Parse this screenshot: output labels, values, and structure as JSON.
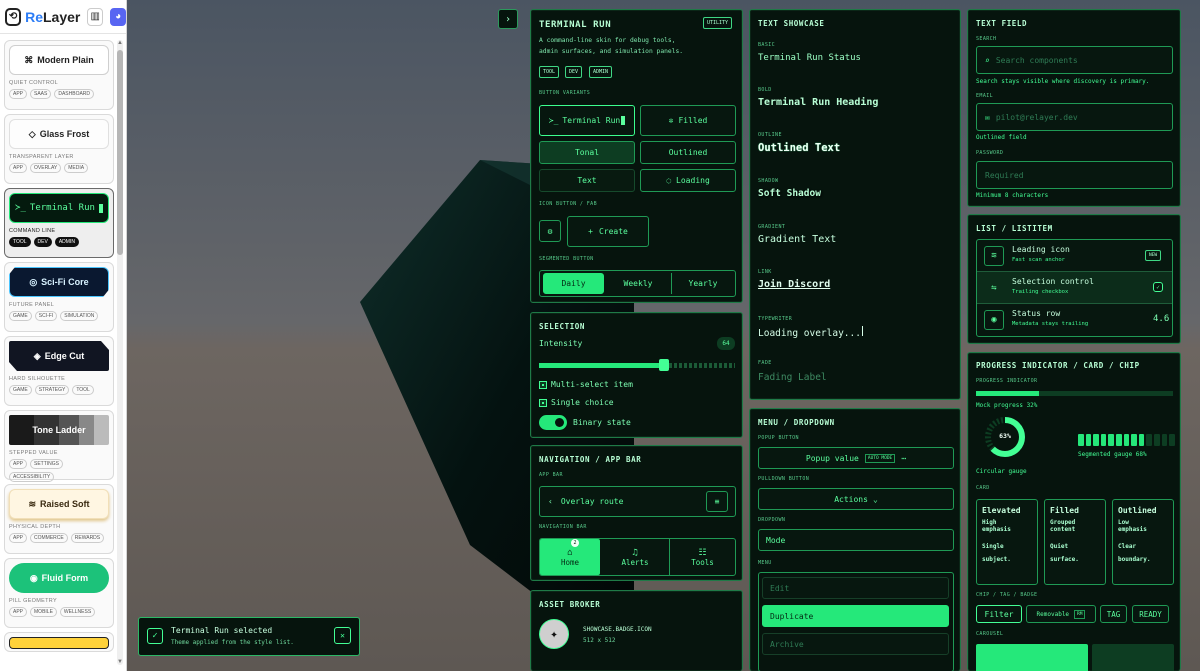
{
  "brand": {
    "name_prefix": "Re",
    "name_suffix": "Layer"
  },
  "sidebar": {
    "styles": [
      {
        "label": "Modern Plain",
        "icon": "⌘",
        "subtitle": "QUIET CONTROL",
        "tags": [
          "APP",
          "SAAS",
          "DASHBOARD"
        ]
      },
      {
        "label": "Glass Frost",
        "icon": "◇",
        "subtitle": "TRANSPARENT LAYER",
        "tags": [
          "APP",
          "OVERLAY",
          "MEDIA"
        ]
      },
      {
        "label": "Terminal Run",
        "icon": "≻_",
        "subtitle": "COMMAND LINE",
        "tags": [
          "TOOL",
          "DEV",
          "ADMIN"
        ]
      },
      {
        "label": "Sci-Fi Core",
        "icon": "◎",
        "subtitle": "FUTURE PANEL",
        "tags": [
          "GAME",
          "SCI-FI",
          "SIMULATION"
        ]
      },
      {
        "label": "Edge Cut",
        "icon": "◈",
        "subtitle": "HARD SILHOUETTE",
        "tags": [
          "GAME",
          "STRATEGY",
          "TOOL"
        ]
      },
      {
        "label": "Tone Ladder",
        "icon": "",
        "subtitle": "STEPPED VALUE",
        "tags": [
          "APP",
          "SETTINGS",
          "ACCESSIBILITY"
        ]
      },
      {
        "label": "Raised Soft",
        "icon": "≋",
        "subtitle": "PHYSICAL DEPTH",
        "tags": [
          "APP",
          "COMMERCE",
          "REWARDS"
        ]
      },
      {
        "label": "Fluid Form",
        "icon": "◉",
        "subtitle": "PILL GEOMETRY",
        "tags": [
          "APP",
          "MOBILE",
          "WELLNESS"
        ]
      }
    ]
  },
  "terminal": {
    "title": "TERMINAL RUN",
    "badge": "UTILITY",
    "description_1": "A command-line skin for debug tools,",
    "description_2": "admin surfaces, and simulation panels.",
    "tags": [
      "TOOL",
      "DEV",
      "ADMIN"
    ],
    "button_variants_label": "BUTTON VARIANTS",
    "buttons": {
      "primary": "Terminal Run",
      "filled": "Filled",
      "tonal": "Tonal",
      "outlined": "Outlined",
      "text": "Text",
      "loading": "Loading"
    },
    "icon_button_label": "ICON BUTTON / FAB",
    "create": "Create",
    "segmented_label": "SEGMENTED BUTTON",
    "segments": [
      "Daily",
      "Weekly",
      "Yearly"
    ]
  },
  "selection": {
    "title": "SELECTION",
    "intensity_label": "Intensity",
    "intensity_value": "64",
    "multi": "Multi-select item",
    "single": "Single choice",
    "binary": "Binary state"
  },
  "navigation": {
    "title": "NAVIGATION / APP BAR",
    "app_bar_label": "APP BAR",
    "route": "Overlay route",
    "nav_bar_label": "NAVIGATION BAR",
    "tabs": [
      "Home",
      "Alerts",
      "Tools"
    ],
    "home_badge": "2"
  },
  "asset": {
    "title": "ASSET BROKER",
    "name": "SHOWCASE.BADGE.ICON",
    "size": "512 x 512"
  },
  "text_showcase": {
    "title": "TEXT SHOWCASE",
    "items": [
      {
        "label": "BASIC",
        "text": "Terminal Run Status"
      },
      {
        "label": "BOLD",
        "text": "Terminal Run Heading"
      },
      {
        "label": "OUTLINE",
        "text": "Outlined Text"
      },
      {
        "label": "SHADOW",
        "text": "Soft Shadow"
      },
      {
        "label": "GRADIENT",
        "text": "Gradient Text"
      },
      {
        "label": "LINK",
        "text": "Join Discord"
      },
      {
        "label": "TYPEWRITER",
        "text": "Loading overlay..."
      },
      {
        "label": "FADE",
        "text": "Fading Label"
      }
    ]
  },
  "menu": {
    "title": "MENU / DROPDOWN",
    "popup_label": "POPUP BUTTON",
    "popup_value": "Popup value",
    "popup_mode": "AUTO MODE",
    "pulldown_label": "PULLDOWN BUTTON",
    "actions": "Actions",
    "dropdown_label": "DROPDOWN",
    "mode": "Mode",
    "menu_label": "MENU",
    "items": [
      "Edit",
      "Duplicate",
      "Archive"
    ]
  },
  "text_field": {
    "title": "TEXT FIELD",
    "search_label": "SEARCH",
    "search_placeholder": "Search components",
    "search_help": "Search stays visible where discovery is primary.",
    "email_label": "EMAIL",
    "email_placeholder": "pilot@relayer.dev",
    "email_help": "Outlined field",
    "password_label": "PASSWORD",
    "password_placeholder": "Required",
    "password_help": "Minimum 8 characters"
  },
  "list": {
    "title": "LIST / LISTITEM",
    "items": [
      {
        "title": "Leading icon",
        "sub": "Fast scan anchor",
        "trail": "NEW"
      },
      {
        "title": "Selection control",
        "sub": "Trailing checkbox",
        "trail": ""
      },
      {
        "title": "Status row",
        "sub": "Metadata stays trailing",
        "trail": "4.6"
      }
    ]
  },
  "progress": {
    "title": "PROGRESS INDICATOR / CARD / CHIP",
    "indicator_label": "PROGRESS INDICATOR",
    "mock_label": "Mock progress 32%",
    "mock_value": 0.32,
    "circular_value": "63%",
    "circular_label": "Circular gauge",
    "segmented_label": "Segmented gauge 68%",
    "segmented_fraction": 0.68,
    "card_label": "CARD",
    "cards": [
      {
        "title": "Elevated",
        "l1": "High",
        "l2": "emphasis",
        "l3": "Single",
        "l4": "subject."
      },
      {
        "title": "Filled",
        "l1": "Grouped",
        "l2": "content",
        "l3": "Quiet",
        "l4": "surface."
      },
      {
        "title": "Outlined",
        "l1": "Low",
        "l2": "emphasis",
        "l3": "Clear",
        "l4": "boundary."
      }
    ],
    "chip_label": "CHIP / TAG / BADGE",
    "chips": {
      "filter": "Filter",
      "removable": "Removable",
      "removable_key": "RM",
      "tag": "TAG",
      "ready": "READY"
    },
    "carousel_label": "CAROUSEL"
  },
  "toast": {
    "title": "Terminal Run selected",
    "message": "Theme applied from the style list."
  }
}
